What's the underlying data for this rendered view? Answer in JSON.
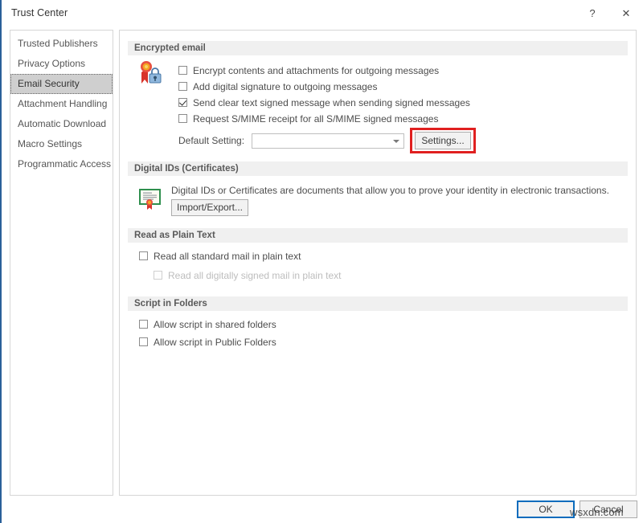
{
  "window": {
    "title": "Trust Center",
    "help_label": "?",
    "close_label": "✕"
  },
  "sidebar": {
    "items": [
      {
        "label": "Trusted Publishers",
        "selected": false
      },
      {
        "label": "Privacy Options",
        "selected": false
      },
      {
        "label": "Email Security",
        "selected": true
      },
      {
        "label": "Attachment Handling",
        "selected": false
      },
      {
        "label": "Automatic Download",
        "selected": false
      },
      {
        "label": "Macro Settings",
        "selected": false
      },
      {
        "label": "Programmatic Access",
        "selected": false
      }
    ]
  },
  "sections": {
    "encrypted_email": {
      "header": "Encrypted email",
      "icon": "certificate-lock-icon",
      "checkboxes": [
        {
          "label": "Encrypt contents and attachments for outgoing messages",
          "checked": false,
          "enabled": true
        },
        {
          "label": "Add digital signature to outgoing messages",
          "checked": false,
          "enabled": true
        },
        {
          "label": "Send clear text signed message when sending signed messages",
          "checked": true,
          "enabled": true
        },
        {
          "label": "Request S/MIME receipt for all S/MIME signed messages",
          "checked": false,
          "enabled": true
        }
      ],
      "default_setting_label": "Default Setting:",
      "default_setting_value": "",
      "settings_button": "Settings...",
      "highlight_color": "#e02020"
    },
    "digital_ids": {
      "header": "Digital IDs (Certificates)",
      "icon": "certificate-document-icon",
      "description": "Digital IDs or Certificates are documents that allow you to prove your identity in electronic transactions.",
      "import_export_button": "Import/Export..."
    },
    "read_as_plain_text": {
      "header": "Read as Plain Text",
      "checkboxes": [
        {
          "label": "Read all standard mail in plain text",
          "checked": false,
          "enabled": true
        },
        {
          "label": "Read all digitally signed mail in plain text",
          "checked": false,
          "enabled": false
        }
      ]
    },
    "script_in_folders": {
      "header": "Script in Folders",
      "checkboxes": [
        {
          "label": "Allow script in shared folders",
          "checked": false,
          "enabled": true
        },
        {
          "label": "Allow script in Public Folders",
          "checked": false,
          "enabled": true
        }
      ]
    }
  },
  "footer": {
    "ok_label": "OK",
    "cancel_label": "Cancel"
  },
  "watermark": {
    "text": "wsxdn.com"
  }
}
